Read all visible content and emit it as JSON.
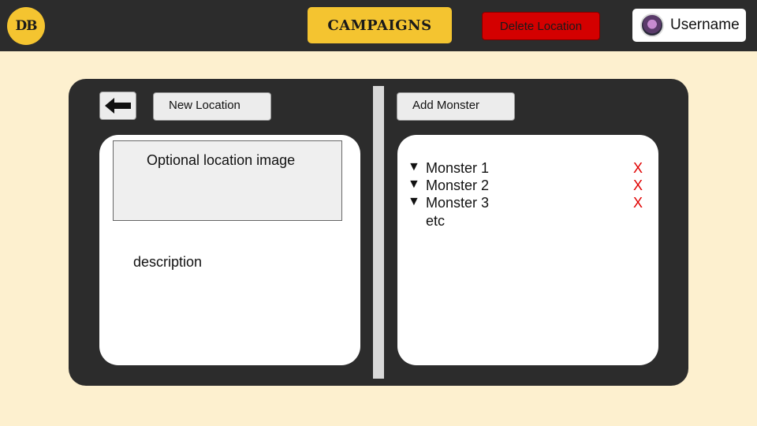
{
  "header": {
    "logo_text": "DB",
    "campaigns_label": "CAMPAIGNS",
    "delete_label": "Delete Location",
    "username": "Username"
  },
  "toolbar": {
    "new_location_label": "New Location",
    "add_monster_label": "Add Monster"
  },
  "location": {
    "image_placeholder": "Optional location image",
    "description": "description"
  },
  "monsters": [
    {
      "name": "Monster 1",
      "remove": "X"
    },
    {
      "name": "Monster 2",
      "remove": "X"
    },
    {
      "name": "Monster 3",
      "remove": "X"
    }
  ],
  "monsters_more": "etc",
  "icons": {
    "back": "arrow-left-icon",
    "expand": "triangle-down-icon"
  },
  "colors": {
    "accent": "#f4c430",
    "danger": "#d40000",
    "dark": "#2c2c2c",
    "background": "#fdf0cf",
    "remove": "#e00000"
  }
}
